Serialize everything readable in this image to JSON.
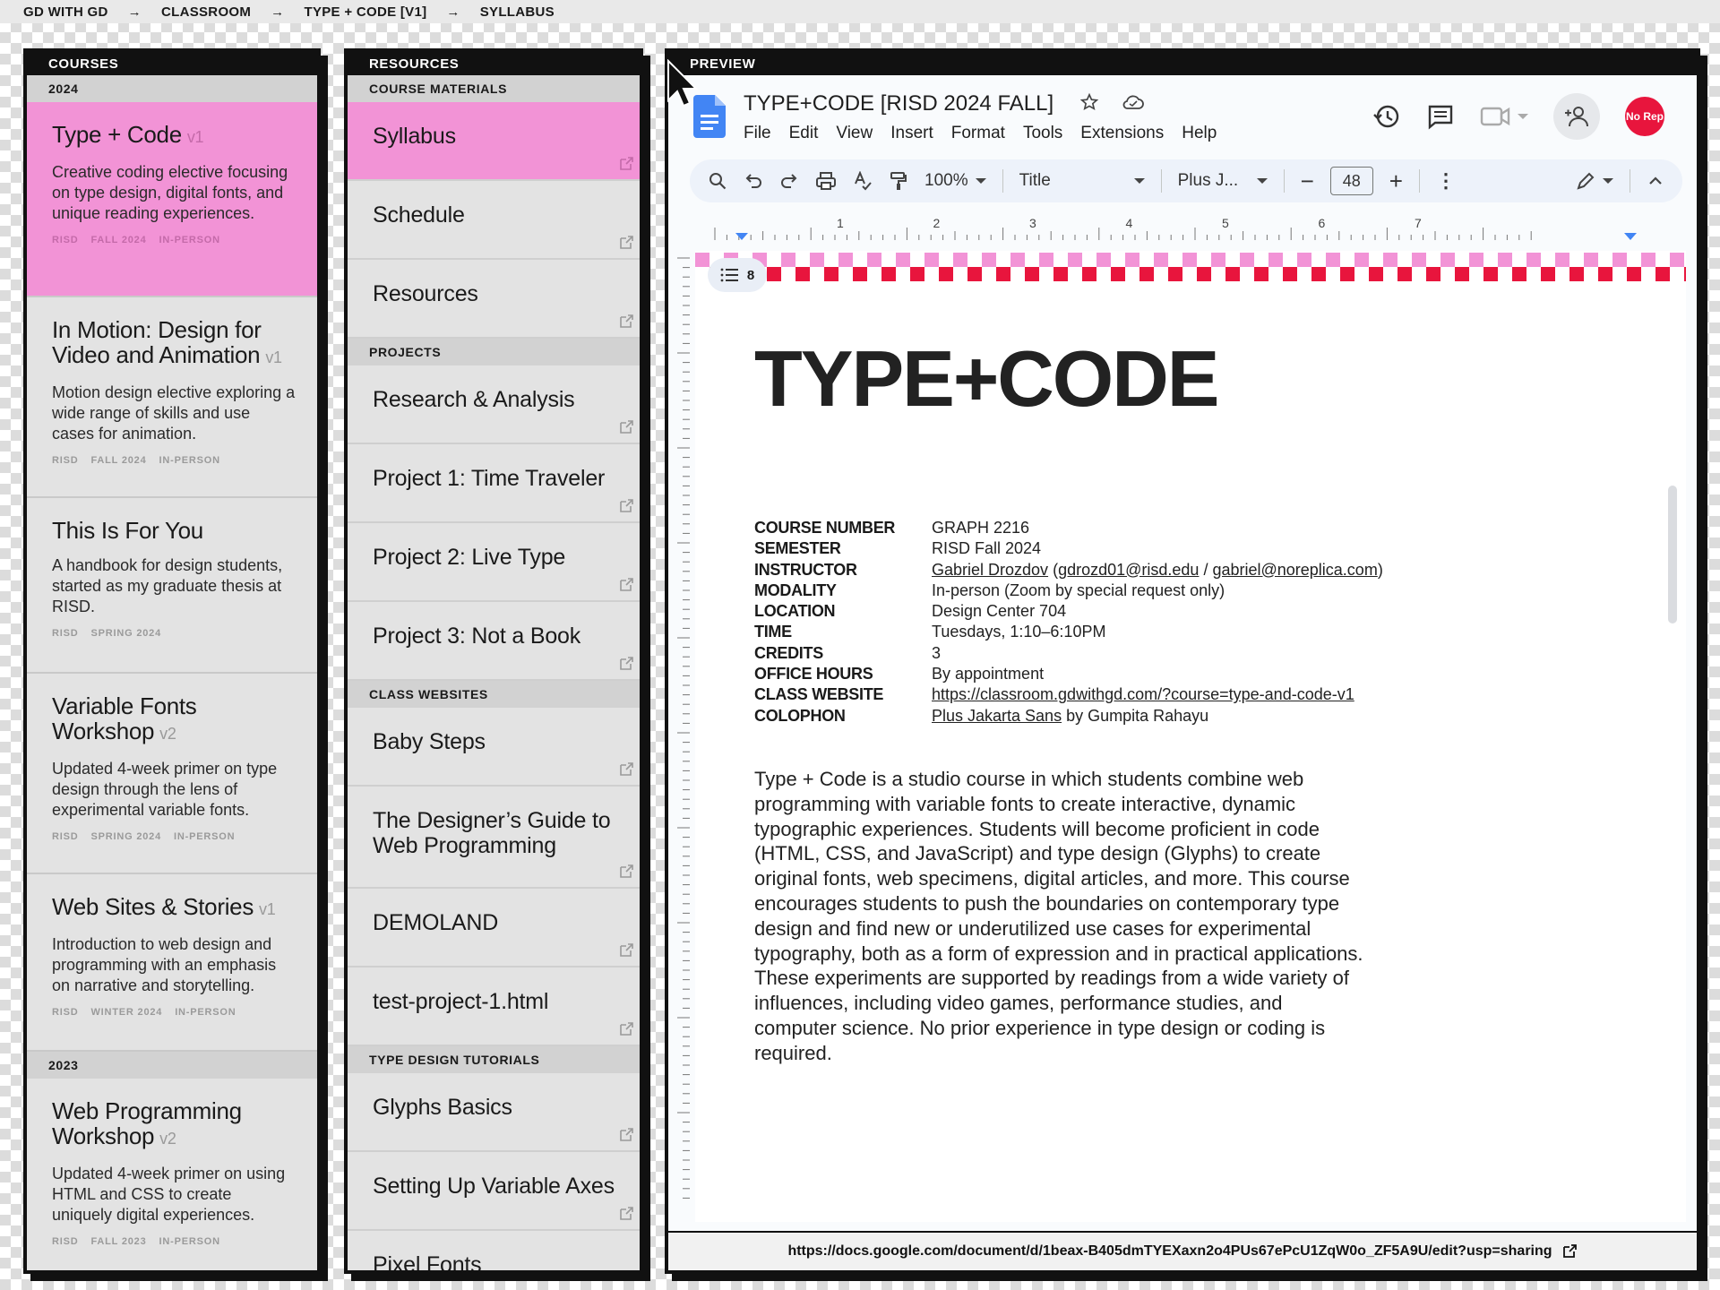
{
  "breadcrumb": [
    "GD WITH GD",
    "CLASSROOM",
    "TYPE + CODE [V1]",
    "SYLLABUS"
  ],
  "breadcrumb_separator": "→",
  "courses_panel": {
    "header": "COURSES",
    "year_2024": "2024",
    "year_2023": "2023",
    "items": [
      {
        "title": "Type + Code",
        "version": "v1",
        "desc": "Creative coding elective focusing on type design, digital fonts, and unique reading experiences.",
        "tags": [
          "RISD",
          "FALL 2024",
          "IN-PERSON"
        ],
        "active": true
      },
      {
        "title": "In Motion: Design for Video and Animation",
        "version": "v1",
        "desc": "Motion design elective exploring a wide range of skills and use cases for animation.",
        "tags": [
          "RISD",
          "FALL 2024",
          "IN-PERSON"
        ]
      },
      {
        "title": "This Is For You",
        "version": "",
        "desc": "A handbook for design students, started as my graduate thesis at RISD.",
        "tags": [
          "RISD",
          "SPRING 2024"
        ]
      },
      {
        "title": "Variable Fonts Workshop",
        "version": "v2",
        "desc": "Updated 4-week primer on type design through the lens of experimental variable fonts.",
        "tags": [
          "RISD",
          "SPRING 2024",
          "IN-PERSON"
        ]
      },
      {
        "title": "Web Sites & Stories",
        "version": "v1",
        "desc": "Introduction to web design and programming with an emphasis on narrative and storytelling.",
        "tags": [
          "RISD",
          "WINTER 2024",
          "IN-PERSON"
        ]
      },
      {
        "title": "Web Programming Workshop",
        "version": "v2",
        "desc": "Updated 4-week primer on using HTML and CSS to create uniquely digital experiences.",
        "tags": [
          "RISD",
          "FALL 2023",
          "IN-PERSON"
        ]
      }
    ]
  },
  "resources_panel": {
    "header": "RESOURCES",
    "sections": [
      {
        "label": "COURSE MATERIALS",
        "items": [
          "Syllabus",
          "Schedule",
          "Resources"
        ]
      },
      {
        "label": "PROJECTS",
        "items": [
          "Research & Analysis",
          "Project 1: Time Traveler",
          "Project 2: Live Type",
          "Project 3: Not a Book"
        ]
      },
      {
        "label": "CLASS WEBSITES",
        "items": [
          "Baby Steps",
          "The Designer’s Guide to Web Programming",
          "DEMOLAND",
          "test-project-1.html"
        ]
      },
      {
        "label": "TYPE DESIGN TUTORIALS",
        "items": [
          "Glyphs Basics",
          "Setting Up Variable Axes",
          "Pixel Fonts"
        ]
      }
    ]
  },
  "preview": {
    "header": "PREVIEW",
    "doc_title": "TYPE+CODE [RISD 2024 FALL]",
    "menu": [
      "File",
      "Edit",
      "View",
      "Insert",
      "Format",
      "Tools",
      "Extensions",
      "Help"
    ],
    "avatar_text": "No Rep",
    "toolbar": {
      "zoom": "100%",
      "style": "Title",
      "font": "Plus J...",
      "font_size": "48"
    },
    "outline_count": "8",
    "ruler_numbers": [
      "1",
      "2",
      "3",
      "4",
      "5",
      "6",
      "7"
    ],
    "heading": "TYPE+CODE",
    "info": [
      {
        "key": "COURSE NUMBER",
        "value": "GRAPH 2216"
      },
      {
        "key": "SEMESTER",
        "value": "RISD Fall 2024"
      },
      {
        "key": "INSTRUCTOR",
        "value": "",
        "parts": [
          "Gabriel Drozdov",
          "gdrozd01@risd.edu",
          "gabriel@noreplica.com"
        ]
      },
      {
        "key": "MODALITY",
        "value": "In-person (Zoom by special request only)"
      },
      {
        "key": "LOCATION",
        "value": "Design Center 704"
      },
      {
        "key": "TIME",
        "value": "Tuesdays, 1:10–6:10PM"
      },
      {
        "key": "CREDITS",
        "value": "3"
      },
      {
        "key": "OFFICE HOURS",
        "value": "By appointment"
      },
      {
        "key": "CLASS WEBSITE",
        "value": "https://classroom.gdwithgd.com/?course=type-and-code-v1"
      },
      {
        "key": "COLOPHON",
        "value": "",
        "parts": [
          "Plus Jakarta Sans",
          " by Gumpita Rahayu"
        ]
      }
    ],
    "description": "Type + Code is a studio course in which students combine web programming with variable fonts to create interactive, dynamic typographic experiences. Students will become proficient in code (HTML, CSS, and JavaScript) and type design (Glyphs) to create original fonts, web specimens, digital articles, and more. This course encourages students to push the boundaries on contemporary type design and find new or underutilized use cases for experimental typography, both as a form of expression and in practical applications. These experiments are supported by readings from a wide variety of influences, including video games, performance studies, and computer science. No prior experience in type design or coding is required.",
    "url": "https://docs.google.com/document/d/1beax-B405dmTYEXaxn2o4PUs67ePcU1ZqW0o_ZF5A9U/edit?usp=sharing"
  },
  "colors": {
    "accent_pink": "#f293d6",
    "avatar_red": "#e8153d",
    "docs_blue": "#4285f4"
  }
}
